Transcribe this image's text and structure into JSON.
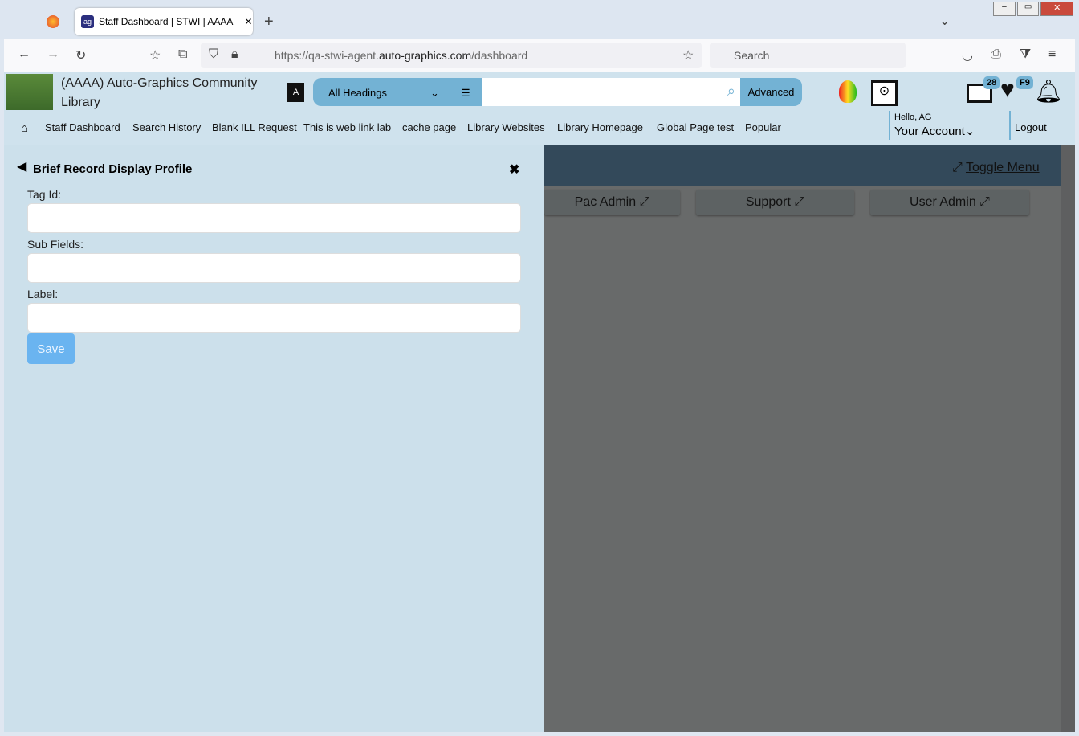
{
  "browser": {
    "tab_title": "Staff Dashboard | STWI | AAAA",
    "url_prefix": "https://qa-stwi-agent.",
    "url_domain": "auto-graphics.com",
    "url_path": "/dashboard",
    "search_placeholder": "Search"
  },
  "header": {
    "library_name": "(AAAA) Auto-Graphics Community Library",
    "search_scope": "All Headings",
    "advanced_label": "Advanced",
    "list_badge": "28",
    "favorites_badge": "F9",
    "greeting": "Hello, AG",
    "account_label": "Your Account",
    "logout_label": "Logout"
  },
  "nav": [
    "Staff Dashboard",
    "Search History",
    "Blank ILL Request",
    "This is web link lab",
    "cache page",
    "Library Websites",
    "Library Homepage",
    "Global Page test",
    "Popular"
  ],
  "panel": {
    "title": "Brief Record Display Profile",
    "tag_label": "Tag Id:",
    "subfields_label": "Sub Fields:",
    "label_label": "Label:",
    "save_label": "Save"
  },
  "main": {
    "toggle_menu": "Toggle Menu",
    "buttons": [
      "Pac Admin",
      "Support",
      "User Admin"
    ]
  }
}
